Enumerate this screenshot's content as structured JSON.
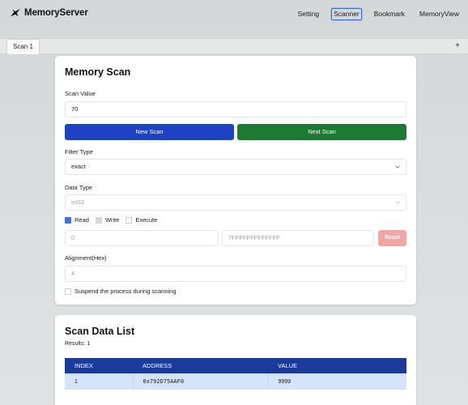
{
  "app": {
    "brand": "MemoryServer",
    "brand_icon": "bird-icon"
  },
  "nav": {
    "items": [
      {
        "label": "Setting"
      },
      {
        "label": "Scanner"
      },
      {
        "label": "Bookmark"
      },
      {
        "label": "MemoryView"
      }
    ],
    "active": "Scanner"
  },
  "tabs": {
    "items": [
      {
        "label": "Scan 1"
      }
    ],
    "add_label": "+"
  },
  "memory_scan": {
    "title": "Memory Scan",
    "scan_value_label": "Scan Value",
    "scan_value": "70",
    "new_scan_label": "New Scan",
    "next_scan_label": "Next Scan",
    "filter_type_label": "Filter Type",
    "filter_type_value": "exact",
    "data_type_label": "Data Type",
    "data_type_value": "int32",
    "protections": [
      {
        "label": "Read",
        "checked": true
      },
      {
        "label": "Write",
        "checked": false
      },
      {
        "label": "Execute",
        "checked": false
      }
    ],
    "start_address": "0",
    "end_address": "7FFFFFFFFFFFFF",
    "reset_label": "Reset",
    "alignment_label": "Alignment(Hex)",
    "alignment_value": "4",
    "suspend_label": "Suspend the process during scanning",
    "suspend_checked": false
  },
  "scan_list": {
    "title": "Scan Data List",
    "results_text": "Results: 1",
    "columns": [
      "INDEX",
      "ADDRESS",
      "VALUE"
    ],
    "rows": [
      [
        "1",
        "0x792D75AAF0",
        "9999"
      ]
    ]
  },
  "colors": {
    "new_scan": "#1d43c4",
    "next_scan": "#1c7a33",
    "reset": "#f3a4a4",
    "table_header": "#1b3a9c",
    "table_row": "#d6e4fb",
    "check_read": "#3b74e0"
  }
}
